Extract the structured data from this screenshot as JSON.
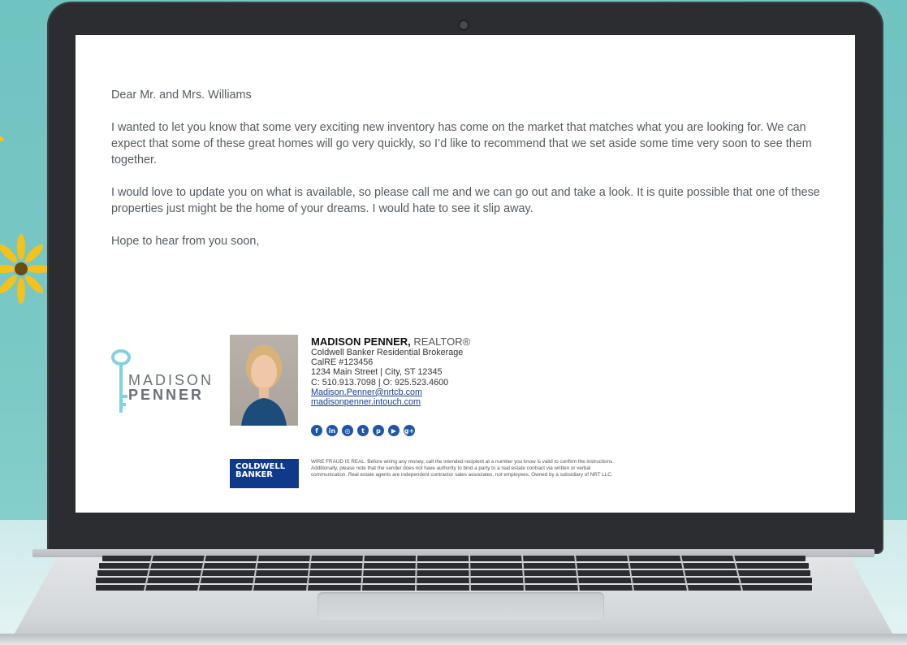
{
  "letter": {
    "greeting": "Dear Mr. and Mrs. Williams",
    "paragraph1": "I wanted to let you know that some very exciting new inventory has come on the market that matches what you are looking for. We can expect that some of these great homes will go very quickly, so I’d like to recommend that we set aside some time very soon to see them together.",
    "paragraph2": "I would love to update you on what is available, so please call me and we can go out and take a look. It is quite possible that one of these properties just might be the home of your dreams. I would hate to see it slip away.",
    "closing": "Hope to hear from you soon,"
  },
  "logo": {
    "line1": "MADISON",
    "line2": "PENNER",
    "icon": "key-icon",
    "color": "#7fd3e0"
  },
  "signature": {
    "name": "MADISON PENNER,",
    "title": "REALTOR®",
    "company": "Coldwell Banker Residential Brokerage",
    "license": "CalRE #123456",
    "address": "1234 Main Street | City, ST 12345",
    "phones": "C: 510.913.7098 | O: 925.523.4600",
    "email": "Madison.Penner@nrtcb.com",
    "website": "madisonpenner.intouch.com"
  },
  "socials": [
    {
      "icon": "facebook-icon",
      "glyph": "f"
    },
    {
      "icon": "linkedin-icon",
      "glyph": "in"
    },
    {
      "icon": "instagram-icon",
      "glyph": "◎"
    },
    {
      "icon": "twitter-icon",
      "glyph": "t"
    },
    {
      "icon": "pinterest-icon",
      "glyph": "p"
    },
    {
      "icon": "youtube-icon",
      "glyph": "▶"
    },
    {
      "icon": "google-plus-icon",
      "glyph": "g+"
    }
  ],
  "broker_logo": {
    "line1": "COLDWELL",
    "line2": "BANKER",
    "color": "#0f3a8a"
  },
  "disclaimer": "WIRE FRAUD IS REAL. Before wiring any money, call the intended recipient at a number you know is valid to confirm the instructions. Additionally, please note that the sender does not have authority to bind a party to a real estate contract via written or verbal communication. Real estate agents are independent contractor sales associates, not employees. Owned by a subsidiary of NRT LLC.",
  "colors": {
    "background": "#74c6c3",
    "link": "#1a3d8f",
    "social": "#1f57a8"
  }
}
